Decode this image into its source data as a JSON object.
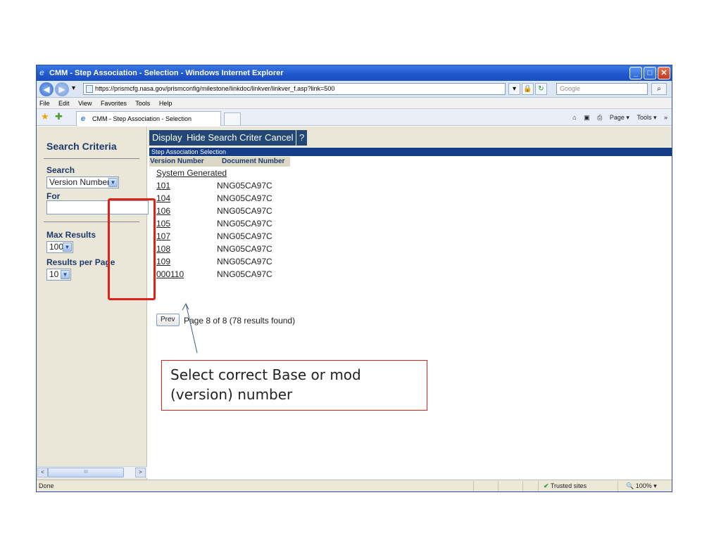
{
  "window": {
    "title": "CMM - Step Association - Selection - Windows Internet Explorer",
    "minimize": "_",
    "maximize": "□",
    "close": "✕"
  },
  "address": {
    "url": "https://prismcfg.nasa.gov/prismconfig/milestone/linkdoc/linkver/linkver_f.asp?link=500",
    "search_placeholder": "Google",
    "back": "◀",
    "forward": "▶",
    "dropdown": "▾",
    "refresh": "↻",
    "stop": "✕",
    "lock": "🔒",
    "search_go": "⌕"
  },
  "menu": [
    "File",
    "Edit",
    "View",
    "Favorites",
    "Tools",
    "Help"
  ],
  "favorites": {
    "tab_label": "CMM - Step Association - Selection",
    "home": "⌂",
    "feeds": "▣",
    "print": "⎙",
    "page": "Page ▾",
    "tools": "Tools ▾",
    "more": "»"
  },
  "sidebar": {
    "heading": "Search Criteria",
    "search_label": "Search",
    "search_value": "Version Number",
    "for_label": "For",
    "for_value": "",
    "max_results_label": "Max Results",
    "max_results_value": "100",
    "results_per_page_label": "Results per Page",
    "results_per_page_value": "10",
    "scroll_left": "<",
    "scroll_right": ">",
    "scroll_thumb": "III"
  },
  "toolbar": {
    "display": "Display",
    "hide_search": "Hide Search Criteria",
    "cancel": "Cancel",
    "help": "?"
  },
  "results": {
    "section_title": "Step Association Selection",
    "col_version": "Version Number",
    "col_document": "Document Number",
    "system_generated": "System Generated",
    "rows": [
      {
        "version": "101",
        "document": "NNG05CA97C"
      },
      {
        "version": "104",
        "document": "NNG05CA97C"
      },
      {
        "version": "106",
        "document": "NNG05CA97C"
      },
      {
        "version": "105",
        "document": "NNG05CA97C"
      },
      {
        "version": "107",
        "document": "NNG05CA97C"
      },
      {
        "version": "108",
        "document": "NNG05CA97C"
      },
      {
        "version": "109",
        "document": "NNG05CA97C"
      },
      {
        "version": "000110",
        "document": "NNG05CA97C"
      }
    ],
    "prev_label": "Prev",
    "pager_text": "Page 8 of 8    (78 results found)"
  },
  "annotation": {
    "callout_line1": "Select correct Base or mod",
    "callout_line2": "(version) number",
    "highlight_color": "#e0211a"
  },
  "status": {
    "left": "Done",
    "zone": "Trusted sites",
    "zone_icon": "✔",
    "zoom": "100%",
    "zoom_icon": "🔍"
  },
  "colors": {
    "section_bar": "#163d87",
    "button_bg": "#234775",
    "sidebar_bg": "#ebe7d8"
  }
}
